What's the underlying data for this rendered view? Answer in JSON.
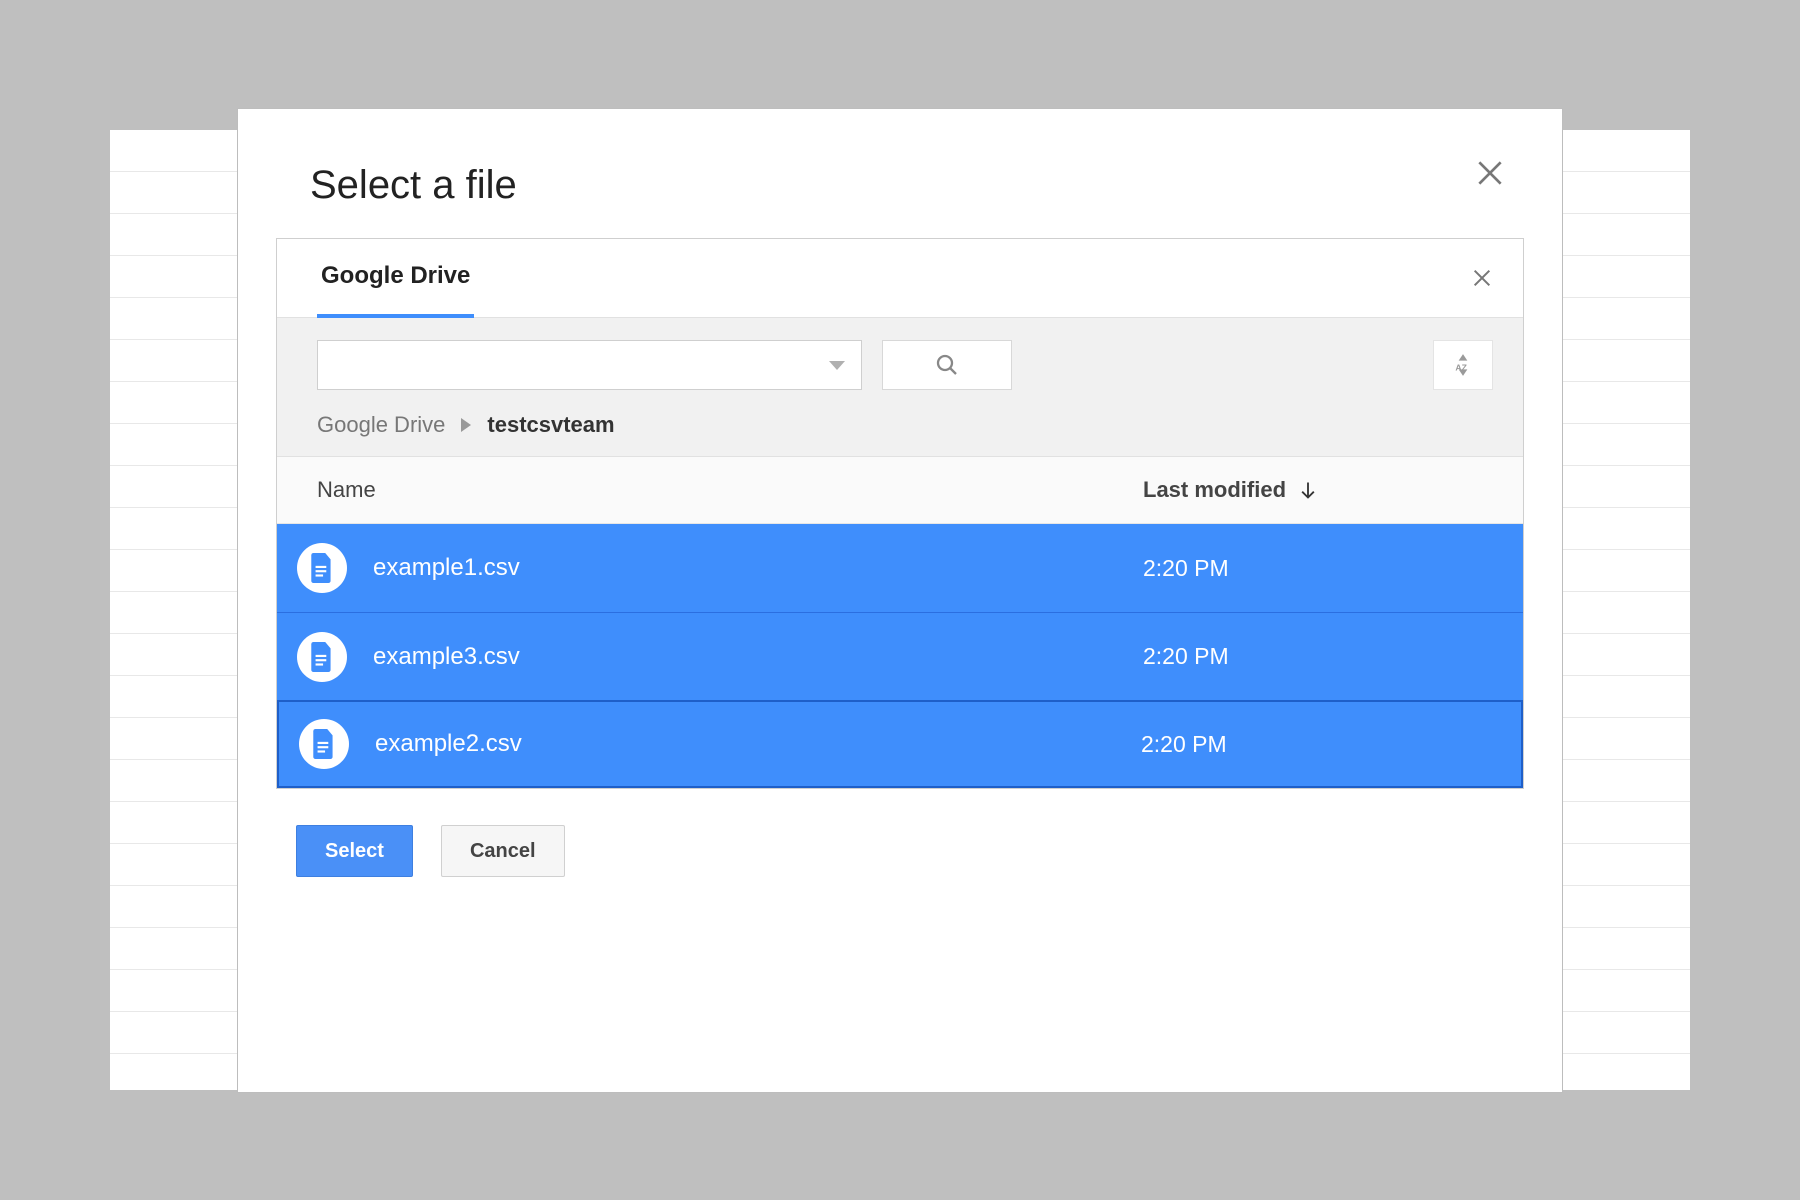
{
  "dialog": {
    "title": "Select a file",
    "tab_label": "Google Drive",
    "breadcrumb": {
      "root": "Google Drive",
      "current": "testcsvteam"
    },
    "columns": {
      "name": "Name",
      "modified": "Last modified"
    },
    "files": [
      {
        "name": "example1.csv",
        "modified": "2:20 PM"
      },
      {
        "name": "example3.csv",
        "modified": "2:20 PM"
      },
      {
        "name": "example2.csv",
        "modified": "2:20 PM"
      }
    ],
    "buttons": {
      "select": "Select",
      "cancel": "Cancel"
    }
  }
}
